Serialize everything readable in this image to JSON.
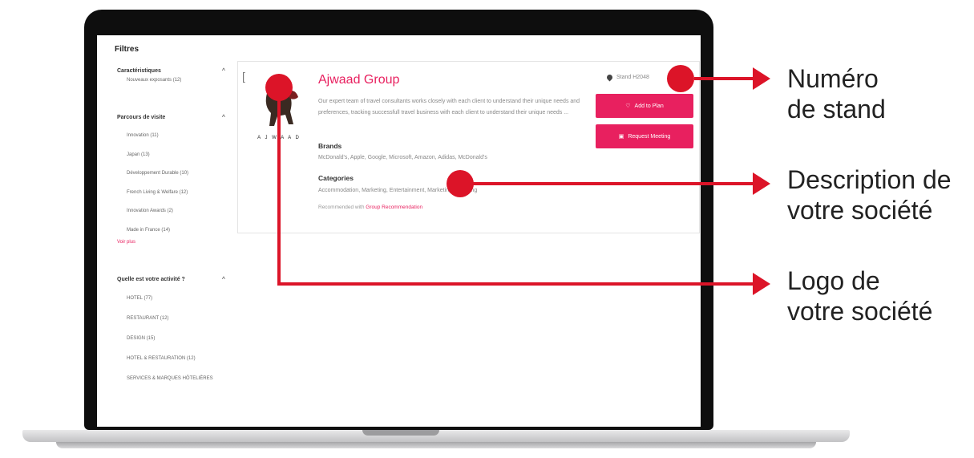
{
  "sidebar": {
    "title": "Filtres",
    "groups": [
      {
        "label": "Caractéristiques",
        "options": [
          "Nouveaux exposants (12)"
        ]
      },
      {
        "label": "Parcours de visite",
        "options": [
          "Innovation (11)",
          "Japan (13)",
          "Développement Durable (10)",
          "French Living & Welfare (12)",
          "Innovation Awards (2)",
          "Made in France (14)"
        ],
        "more": "Voir plus"
      },
      {
        "label": "Quelle est votre activité ?",
        "options": [
          "HOTEL (77)",
          "RESTAURANT (12)",
          "DESIGN (15)",
          "HOTEL & RESTAURATION (12)",
          "SERVICES & MARQUES HÔTELIÈRES"
        ]
      }
    ]
  },
  "exhibitor": {
    "logo_text": "A J W A A D",
    "name": "Ajwaad Group",
    "description": "Our expert team of travel consultants works closely with each client to understand their unique needs and preferences, tracking successfull travel business with each client to understand their unique needs ...",
    "brands_title": "Brands",
    "brands": "McDonald's, Apple, Google, Microsoft, Amazon, Adidas, McDonald's",
    "categories_title": "Categories",
    "categories": "Accommodation, Marketing, Entertainment, Marketing, Wedding",
    "rec_prefix": "Recommended with",
    "rec_link": "Group Recommendation",
    "stand": "Stand H2048",
    "btn_add": "Add to Plan",
    "btn_meeting": "Request Meeting"
  },
  "annotations": {
    "stand_line1": "Numéro",
    "stand_line2": "de stand",
    "desc_line1": "Description de",
    "desc_line2": "votre société",
    "logo_line1": "Logo de",
    "logo_line2": "votre société"
  },
  "colors": {
    "accent": "#e8205f",
    "annotation_red": "#dc1428"
  }
}
